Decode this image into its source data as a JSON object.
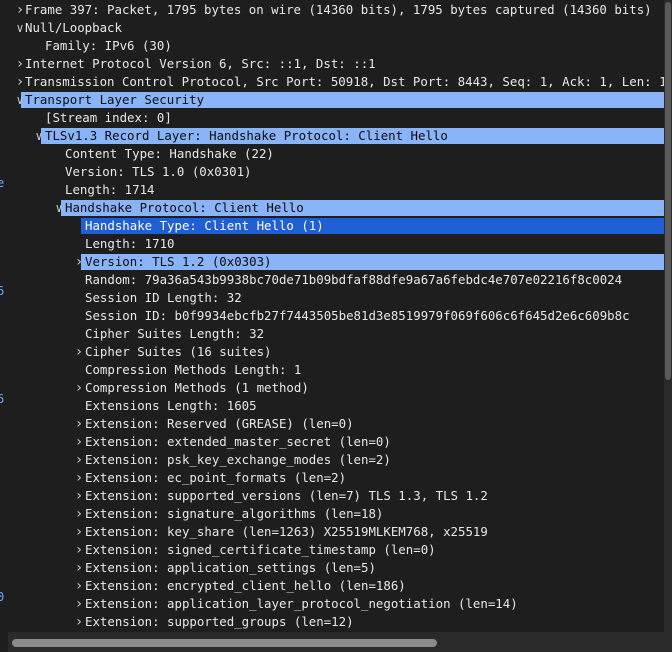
{
  "tree": {
    "rows": [
      {
        "label": "Frame 397: Packet, 1795 bytes on wire (14360 bits), 1795 bytes captured (14360 bits)",
        "arrow": "collapsed"
      },
      {
        "label": "Null/Loopback",
        "arrow": "expanded"
      },
      {
        "label": "Family: IPv6 (30)",
        "arrow": "none"
      },
      {
        "label": "Internet Protocol Version 6, Src: ::1, Dst: ::1",
        "arrow": "collapsed"
      },
      {
        "label": "Transmission Control Protocol, Src Port: 50918, Dst Port: 8443, Seq: 1, Ack: 1, Len: 1739",
        "arrow": "collapsed"
      },
      {
        "label": "Transport Layer Security",
        "arrow": "expanded",
        "highlight": "light"
      },
      {
        "label": "[Stream index: 0]",
        "arrow": "none"
      },
      {
        "label": "TLSv1.3 Record Layer: Handshake Protocol: Client Hello",
        "arrow": "expanded",
        "highlight": "light"
      },
      {
        "label": "Content Type: Handshake (22)",
        "arrow": "none"
      },
      {
        "label": "Version: TLS 1.0 (0x0301)",
        "arrow": "none"
      },
      {
        "label": "Length: 1714",
        "arrow": "none"
      },
      {
        "label": "Handshake Protocol: Client Hello",
        "arrow": "expanded",
        "highlight": "light"
      },
      {
        "label": "Handshake Type: Client Hello (1)",
        "arrow": "none",
        "highlight": "dark"
      },
      {
        "label": "Length: 1710",
        "arrow": "none"
      },
      {
        "label": "Version: TLS 1.2 (0x0303)",
        "arrow": "collapsed",
        "highlight": "light"
      },
      {
        "label": "Random: 79a36a543b9938bc70de71b09bdfaf88dfe9a67a6febdc4e707e02216f8c0024",
        "arrow": "none"
      },
      {
        "label": "Session ID Length: 32",
        "arrow": "none"
      },
      {
        "label": "Session ID: b0f9934ebcfb27f7443505be81d3e8519979f069f606c6f645d2e6c609b8c",
        "arrow": "none"
      },
      {
        "label": "Cipher Suites Length: 32",
        "arrow": "none"
      },
      {
        "label": "Cipher Suites (16 suites)",
        "arrow": "collapsed"
      },
      {
        "label": "Compression Methods Length: 1",
        "arrow": "none"
      },
      {
        "label": "Compression Methods (1 method)",
        "arrow": "collapsed"
      },
      {
        "label": "Extensions Length: 1605",
        "arrow": "none"
      },
      {
        "label": "Extension: Reserved (GREASE) (len=0)",
        "arrow": "collapsed"
      },
      {
        "label": "Extension: extended_master_secret (len=0)",
        "arrow": "collapsed"
      },
      {
        "label": "Extension: psk_key_exchange_modes (len=2)",
        "arrow": "collapsed"
      },
      {
        "label": "Extension: ec_point_formats (len=2)",
        "arrow": "collapsed"
      },
      {
        "label": "Extension: supported_versions (len=7) TLS 1.3, TLS 1.2",
        "arrow": "collapsed"
      },
      {
        "label": "Extension: signature_algorithms (len=18)",
        "arrow": "collapsed"
      },
      {
        "label": "Extension: key_share (len=1263) X25519MLKEM768, x25519",
        "arrow": "collapsed"
      },
      {
        "label": "Extension: signed_certificate_timestamp (len=0)",
        "arrow": "collapsed"
      },
      {
        "label": "Extension: application_settings (len=5)",
        "arrow": "collapsed"
      },
      {
        "label": "Extension: encrypted_client_hello (len=186)",
        "arrow": "collapsed"
      },
      {
        "label": "Extension: application_layer_protocol_negotiation (len=14)",
        "arrow": "collapsed"
      },
      {
        "label": "Extension: supported_groups (len=12)",
        "arrow": "collapsed"
      }
    ]
  },
  "icons": {
    "collapsed": "chevron-right-icon",
    "expanded": "chevron-down-icon"
  },
  "colors": {
    "background": "#1e1e1e",
    "text": "#e8e8e8",
    "highlight_light": "#8ab4f8",
    "highlight_dark": "#1f5fd6"
  }
}
